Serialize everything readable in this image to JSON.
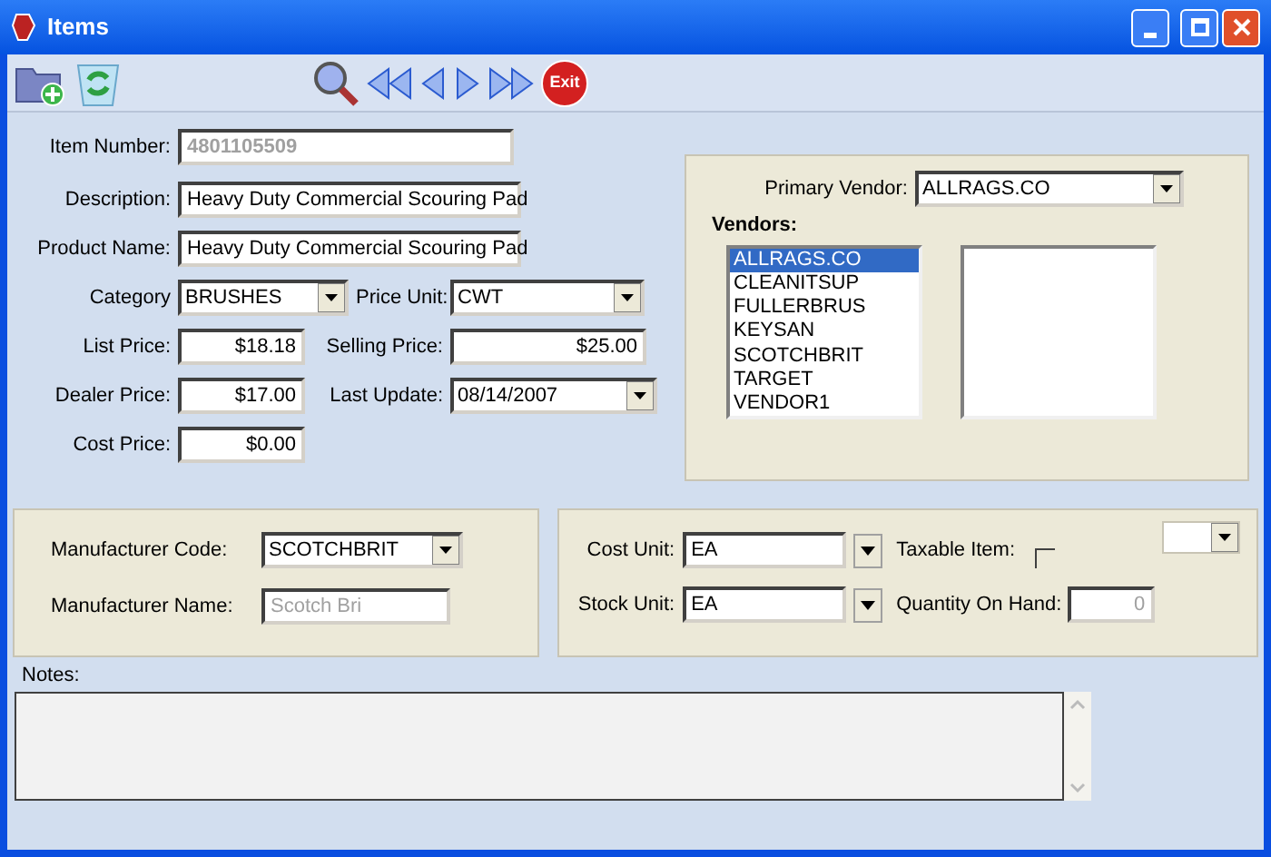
{
  "window": {
    "title": "Items"
  },
  "toolbar": [
    {
      "kind": "add-folder"
    },
    {
      "kind": "recycle"
    },
    {
      "kind": "search"
    },
    {
      "kind": "first"
    },
    {
      "kind": "prev"
    },
    {
      "kind": "next"
    },
    {
      "kind": "last"
    },
    {
      "kind": "exit",
      "label": "Exit"
    }
  ],
  "item": {
    "item_number": {
      "label": "Item Number:",
      "value": "4801105509",
      "disabled": true
    },
    "description": {
      "label": "Description:",
      "value": "Heavy Duty Commercial Scouring Pad"
    },
    "product_name": {
      "label": "Product Name:",
      "value": "Heavy Duty Commercial Scouring Pad"
    },
    "category": {
      "label": "Category",
      "value": "BRUSHES"
    },
    "price_unit": {
      "label": "Price Unit:",
      "value": "CWT"
    },
    "list_price": {
      "label": "List Price:",
      "value": "$18.18"
    },
    "selling_price": {
      "label": "Selling Price:",
      "value": "$25.00"
    },
    "dealer_price": {
      "label": "Dealer Price:",
      "value": "$17.00"
    },
    "last_update": {
      "label": "Last Update:",
      "value": "08/14/2007"
    },
    "cost_price": {
      "label": "Cost Price:",
      "value": "$0.00"
    }
  },
  "vendors": {
    "primary_label": "Primary Vendor:",
    "primary_value": "ALLRAGS.CO",
    "title": "Vendors:",
    "list": [
      {
        "name": "ALLRAGS.CO",
        "selected": true
      },
      {
        "name": "CLEANITSUP",
        "selected": false
      },
      {
        "name": "FULLERBRUS",
        "selected": false
      },
      {
        "name": "KEYSAN",
        "selected": false
      },
      {
        "name": "SCOTCHBRIT",
        "selected": false
      },
      {
        "name": "TARGET",
        "selected": false
      },
      {
        "name": "VENDOR1",
        "selected": false
      }
    ]
  },
  "manufacturer": {
    "code_label": "Manufacturer Code:",
    "code_value": "SCOTCHBRIT",
    "name_label": "Manufacturer Name:",
    "name_value": "Scotch Bri",
    "name_disabled": true
  },
  "units": {
    "cost_label": "Cost Unit:",
    "cost_value": "EA",
    "stock_label": "Stock Unit:",
    "stock_value": "EA",
    "taxable_label": "Taxable Item:",
    "taxable_checked": false,
    "quantity_label": "Quantity On Hand:",
    "quantity_value": "0",
    "quantity_disabled": true
  },
  "notes": {
    "label": "Notes:"
  }
}
